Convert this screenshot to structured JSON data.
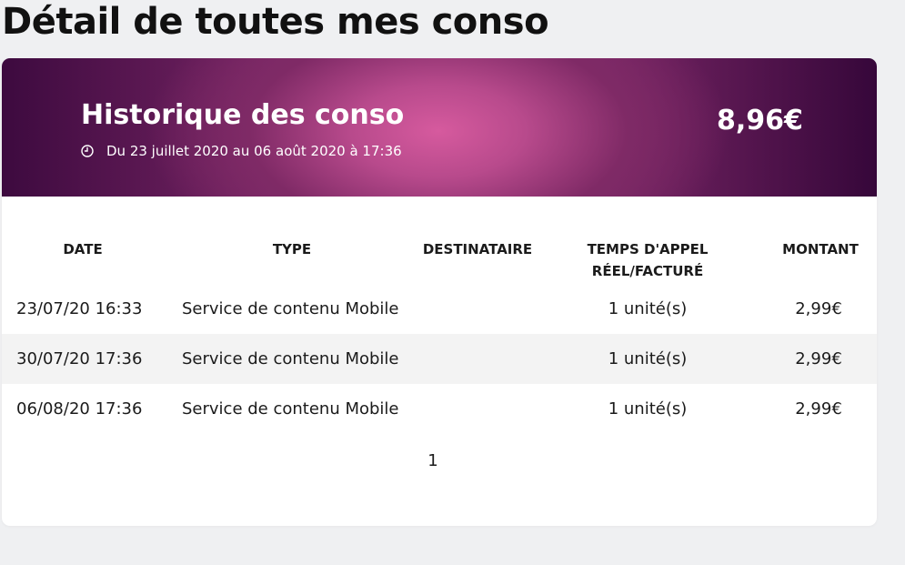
{
  "page": {
    "title": "Détail de toutes mes conso"
  },
  "header": {
    "title": "Historique des conso",
    "period": "Du 23 juillet 2020 au 06 août 2020 à 17:36",
    "total": "8,96€",
    "icon": "clock-icon"
  },
  "table": {
    "columns": {
      "date": "DATE",
      "type": "TYPE",
      "destinataire": "DESTINATAIRE",
      "temps_line1": "TEMPS D'APPEL",
      "temps_line2": "RÉEL/FACTURÉ",
      "montant": "MONTANT"
    },
    "rows": [
      {
        "date": "23/07/20 16:33",
        "type": "Service de contenu Mobile",
        "destinataire": "",
        "temps": "1 unité(s)",
        "montant": "2,99€"
      },
      {
        "date": "30/07/20 17:36",
        "type": "Service de contenu Mobile",
        "destinataire": "",
        "temps": "1 unité(s)",
        "montant": "2,99€"
      },
      {
        "date": "06/08/20 17:36",
        "type": "Service de contenu Mobile",
        "destinataire": "",
        "temps": "1 unité(s)",
        "montant": "2,99€"
      }
    ]
  },
  "pagination": {
    "current_page": "1"
  },
  "colors": {
    "header_gradient_center": "#d65a9e",
    "header_gradient_edge": "#3d0a3f",
    "page_background": "#eff0f2",
    "row_alt_background": "#f3f3f3"
  }
}
